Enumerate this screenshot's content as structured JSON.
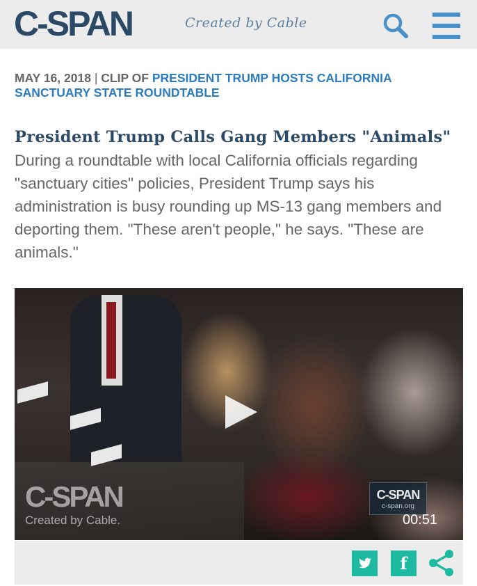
{
  "header": {
    "logo": "C-SPAN",
    "tagline": "Created by Cable",
    "search_icon": "search-icon",
    "menu_icon": "hamburger-menu-icon",
    "accent_color": "#4a90c9",
    "brand_color": "#2c4a66"
  },
  "meta": {
    "date": "MAY 16, 2018",
    "separator": "|",
    "clip_of": "CLIP OF",
    "program_link": "PRESIDENT TRUMP HOSTS CALIFORNIA SANCTUARY STATE ROUNDTABLE"
  },
  "story": {
    "title": "President Trump Calls Gang Members \"Animals\"",
    "description": "During a roundtable with local California officials regarding \"sanctuary cities\" policies, President Trump says his administration is busy rounding up MS-13 gang members and deporting them. \"These aren't people,\" he says. \"These are animals.\""
  },
  "video": {
    "watermark_logo": "C-SPAN",
    "watermark_tagline": "Created by Cable.",
    "bug_logo": "C-SPAN",
    "bug_url": "c-span.org",
    "timecode": "00:51",
    "play_icon": "play-icon"
  },
  "share": {
    "twitter_icon": "twitter-icon",
    "facebook_icon": "facebook-icon",
    "facebook_glyph": "f",
    "share_icon": "share-icon",
    "share_color": "#1db9a0"
  }
}
